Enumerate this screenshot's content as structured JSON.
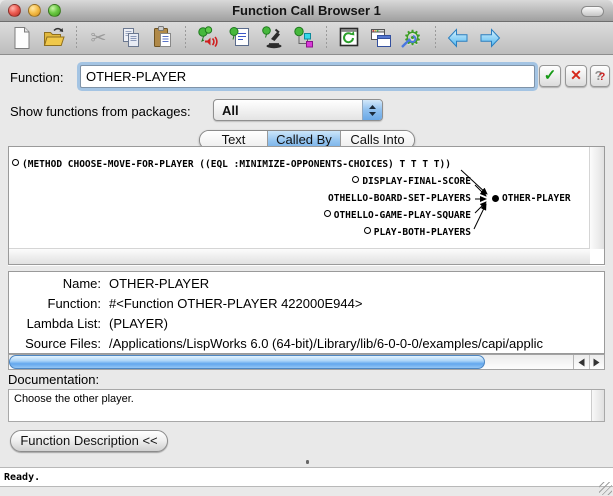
{
  "window": {
    "title": "Function Call Browser 1"
  },
  "toolbar": {
    "icons": [
      "new-document",
      "open-file",
      "cut",
      "copy",
      "paste",
      "listeners",
      "editors",
      "inspect",
      "object-clipboard",
      "refresh",
      "clone-window",
      "preferences",
      "history-back",
      "history-forward"
    ]
  },
  "icons": {
    "scissors": "✂",
    "gear": "⚙",
    "check": "✓",
    "cross": "✕",
    "question": "?"
  },
  "function_row": {
    "label": "Function:",
    "value": "OTHER-PLAYER"
  },
  "packages_row": {
    "label": "Show functions from packages:",
    "value": "All"
  },
  "tabs": [
    {
      "label": "Text",
      "selected": false
    },
    {
      "label": "Called By",
      "selected": true
    },
    {
      "label": "Calls Into",
      "selected": false
    }
  ],
  "graph": {
    "callers": [
      {
        "label": "(METHOD CHOOSE-MOVE-FOR-PLAYER ((EQL :MINIMIZE-OPPONENTS-CHOICES) T T T T))",
        "expandable": true
      },
      {
        "label": "DISPLAY-FINAL-SCORE",
        "expandable": true
      },
      {
        "label": "OTHELLO-BOARD-SET-PLAYERS",
        "expandable": false
      },
      {
        "label": "OTHELLO-GAME-PLAY-SQUARE",
        "expandable": true
      },
      {
        "label": "PLAY-BOTH-PLAYERS",
        "expandable": true
      }
    ],
    "target": {
      "label": "OTHER-PLAYER"
    }
  },
  "details": {
    "rows": [
      {
        "label": "Name:",
        "value": "OTHER-PLAYER"
      },
      {
        "label": "Function:",
        "value": "#<Function OTHER-PLAYER 422000E944>"
      },
      {
        "label": "Lambda List:",
        "value": "(PLAYER)"
      },
      {
        "label": "Source Files:",
        "value": "/Applications/LispWorks 6.0 (64-bit)/Library/lib/6-0-0-0/examples/capi/applic"
      }
    ]
  },
  "documentation": {
    "label": "Documentation:",
    "text": "Choose the other player."
  },
  "description_button": {
    "label": "Function Description <<"
  },
  "status": {
    "text": "Ready."
  },
  "colors": {
    "accent_blue": "#63a7ee",
    "tab_selected": "#8ec2ef",
    "check_green": "#159915",
    "cross_red": "#d6281a",
    "traffic_red": "#ee5f55",
    "traffic_yellow": "#f5bf4c",
    "traffic_green": "#6cc944"
  }
}
